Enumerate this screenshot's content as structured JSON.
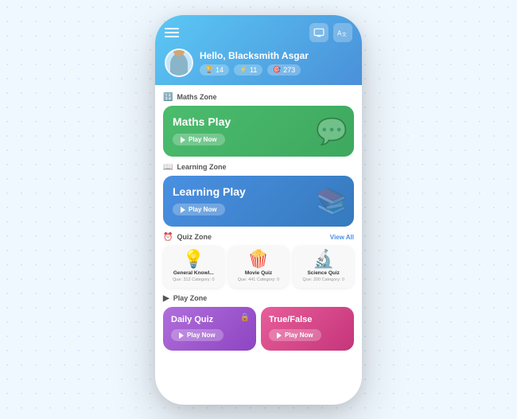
{
  "background": {
    "dot_color": "#a0c4e8"
  },
  "header": {
    "greeting": "Hello, Blacksmith Asgar",
    "stats": [
      {
        "icon": "🏆",
        "value": "14"
      },
      {
        "icon": "⚡",
        "value": "11"
      },
      {
        "icon": "🎯",
        "value": "273"
      }
    ],
    "icon_left": "menu",
    "icon_right1": "screen",
    "icon_right2": "translate"
  },
  "sections": {
    "maths_zone": {
      "label": "Maths Zone",
      "card": {
        "title": "Maths Play",
        "play_label": "Play Now"
      }
    },
    "learning_zone": {
      "label": "Learning Zone",
      "card": {
        "title": "Learning Play",
        "play_label": "Play Now"
      }
    },
    "quiz_zone": {
      "label": "Quiz Zone",
      "view_all": "View All",
      "items": [
        {
          "name": "General Knowl...",
          "emoji": "💡",
          "meta_line1": "Que: 312   Category: 0"
        },
        {
          "name": "Movie Quiz",
          "emoji": "🍿",
          "meta_line1": "Que: 441   Category: 0"
        },
        {
          "name": "Science Quiz",
          "emoji": "🔬",
          "meta_line1": "Que: 200   Category: 0"
        }
      ]
    },
    "play_zone": {
      "label": "Play Zone",
      "cards": [
        {
          "title": "Daily Quiz",
          "play_label": "Play Now",
          "has_lock": true
        },
        {
          "title": "True/False",
          "play_label": "Play Now",
          "has_lock": false
        }
      ]
    }
  }
}
